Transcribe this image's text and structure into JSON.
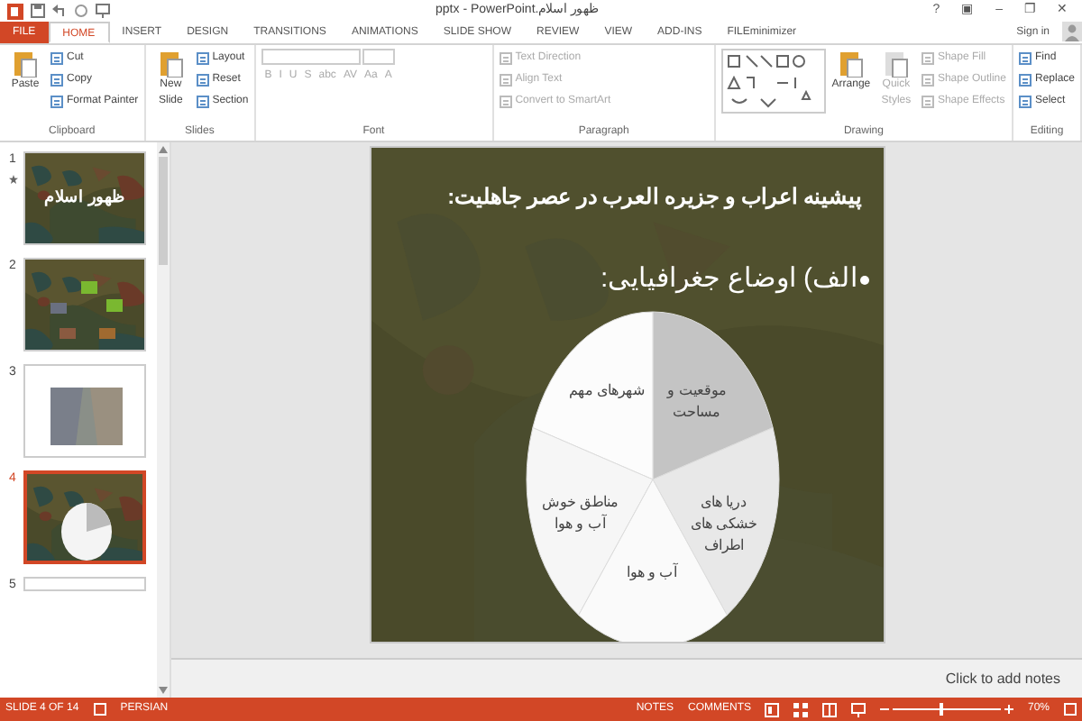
{
  "window": {
    "title": "ظهور اسلام.pptx - PowerPoint",
    "controls": [
      "?",
      "▣",
      "–",
      "❐",
      "✕"
    ]
  },
  "tabs": [
    {
      "label": "FILE",
      "kind": "file",
      "selected": false
    },
    {
      "label": "HOME",
      "kind": "tab",
      "selected": true
    },
    {
      "label": "INSERT",
      "kind": "tab",
      "selected": false
    },
    {
      "label": "DESIGN",
      "kind": "tab",
      "selected": false
    },
    {
      "label": "TRANSITIONS",
      "kind": "tab",
      "selected": false
    },
    {
      "label": "ANIMATIONS",
      "kind": "tab",
      "selected": false
    },
    {
      "label": "SLIDE SHOW",
      "kind": "tab",
      "selected": false
    },
    {
      "label": "REVIEW",
      "kind": "tab",
      "selected": false
    },
    {
      "label": "VIEW",
      "kind": "tab",
      "selected": false
    },
    {
      "label": "ADD-INS",
      "kind": "tab",
      "selected": false
    },
    {
      "label": "FILEminimizer",
      "kind": "tab",
      "selected": false
    }
  ],
  "sign_in": "Sign in",
  "ribbon": [
    {
      "name": "Clipboard",
      "big": [
        {
          "label": "Paste",
          "disabled": false
        }
      ],
      "small": [
        {
          "label": "Cut",
          "disabled": false
        },
        {
          "label": "Copy",
          "disabled": false
        },
        {
          "label": "Format Painter",
          "disabled": false
        }
      ]
    },
    {
      "name": "Slides",
      "big": [
        {
          "label": "New Slide",
          "disabled": false
        }
      ],
      "small": [
        {
          "label": "Layout",
          "disabled": false
        },
        {
          "label": "Reset",
          "disabled": false
        },
        {
          "label": "Section",
          "disabled": false
        }
      ]
    },
    {
      "name": "Font",
      "kind": "font",
      "keys": [
        "B",
        "I",
        "U",
        "S",
        "abc",
        "AV",
        "Aa",
        "A"
      ],
      "disabled": true
    },
    {
      "name": "Paragraph",
      "small": [
        {
          "label": "Text Direction",
          "disabled": true
        },
        {
          "label": "Align Text",
          "disabled": true
        },
        {
          "label": "Convert to SmartArt",
          "disabled": true
        }
      ]
    },
    {
      "name": "Drawing",
      "kind": "drawing",
      "big": [
        {
          "label": "Arrange",
          "disabled": false
        },
        {
          "label": "Quick Styles",
          "disabled": true
        }
      ],
      "small": [
        {
          "label": "Shape Fill",
          "disabled": true
        },
        {
          "label": "Shape Outline",
          "disabled": true
        },
        {
          "label": "Shape Effects",
          "disabled": true
        }
      ]
    },
    {
      "name": "Editing",
      "small": [
        {
          "label": "Find",
          "disabled": false
        },
        {
          "label": "Replace",
          "disabled": false
        },
        {
          "label": "Select",
          "disabled": false
        }
      ]
    }
  ],
  "slides": [
    {
      "number": "1",
      "title": "ظهور اسلام",
      "starred": true,
      "kind": "map",
      "selected": false
    },
    {
      "number": "2",
      "starred": false,
      "kind": "boxes",
      "selected": false
    },
    {
      "number": "3",
      "starred": false,
      "selected": false
    },
    {
      "number": "4",
      "starred": false,
      "kind": "pie",
      "selected": true
    },
    {
      "number": "5",
      "starred": false,
      "kind": "blank",
      "selected": false
    }
  ],
  "slide": {
    "title": "پیشینه اعراب و جزیره العرب در عصر جاهلیت:",
    "bullet": "الف) اوضاع جغرافیایی:",
    "pie": [
      {
        "label": "موقعیت و مساحت",
        "color": "#c4c4c4"
      },
      {
        "label": "شهرهای مهم",
        "color": "#fcfcfc"
      },
      {
        "label": "دریا های خشکی های اطراف",
        "color": "#e8e8e8"
      },
      {
        "label": "مناطق خوش آب و هوا",
        "color": "#f6f6f6"
      },
      {
        "label": "آب و هوا",
        "color": "#fafafa"
      }
    ]
  },
  "notes_placeholder": "Click to add notes",
  "status_bar": {
    "slide": "SLIDE 4 OF 14",
    "language": "PERSIAN",
    "notes": "NOTES",
    "comments": "COMMENTS",
    "zoom": "70%",
    "zoom_slider": {
      "level": 0.45
    }
  }
}
